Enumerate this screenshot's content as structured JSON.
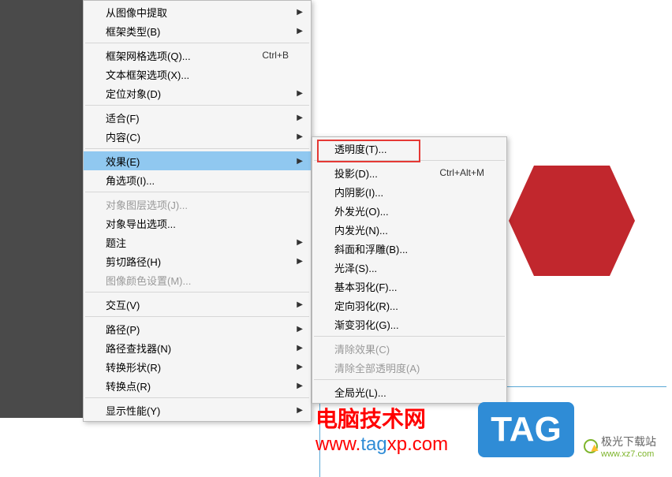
{
  "menu1": {
    "items": [
      {
        "label": "从图像中提取",
        "arrow": true
      },
      {
        "label": "框架类型(B)",
        "arrow": true
      },
      {
        "sep": true
      },
      {
        "label": "框架网格选项(Q)...",
        "accel": "Ctrl+B"
      },
      {
        "label": "文本框架选项(X)..."
      },
      {
        "label": "定位对象(D)",
        "arrow": true
      },
      {
        "sep": true
      },
      {
        "label": "适合(F)",
        "arrow": true
      },
      {
        "label": "内容(C)",
        "arrow": true
      },
      {
        "sep": true
      },
      {
        "label": "效果(E)",
        "arrow": true,
        "highlighted": true
      },
      {
        "label": "角选项(I)..."
      },
      {
        "sep": true
      },
      {
        "label": "对象图层选项(J)...",
        "disabled": true
      },
      {
        "label": "对象导出选项..."
      },
      {
        "label": "题注",
        "arrow": true
      },
      {
        "label": "剪切路径(H)",
        "arrow": true
      },
      {
        "label": "图像颜色设置(M)...",
        "disabled": true
      },
      {
        "sep": true
      },
      {
        "label": "交互(V)",
        "arrow": true
      },
      {
        "sep": true
      },
      {
        "label": "路径(P)",
        "arrow": true
      },
      {
        "label": "路径查找器(N)",
        "arrow": true
      },
      {
        "label": "转换形状(R)",
        "arrow": true
      },
      {
        "label": "转换点(R)",
        "arrow": true
      },
      {
        "sep": true
      },
      {
        "label": "显示性能(Y)",
        "arrow": true
      }
    ]
  },
  "menu2": {
    "items": [
      {
        "label": "透明度(T)..."
      },
      {
        "sep": true
      },
      {
        "label": "投影(D)...",
        "accel": "Ctrl+Alt+M"
      },
      {
        "label": "内阴影(I)..."
      },
      {
        "label": "外发光(O)..."
      },
      {
        "label": "内发光(N)..."
      },
      {
        "label": "斜面和浮雕(B)..."
      },
      {
        "label": "光泽(S)..."
      },
      {
        "label": "基本羽化(F)..."
      },
      {
        "label": "定向羽化(R)..."
      },
      {
        "label": "渐变羽化(G)..."
      },
      {
        "sep": true
      },
      {
        "label": "清除效果(C)",
        "disabled": true
      },
      {
        "label": "清除全部透明度(A)",
        "disabled": true
      },
      {
        "sep": true
      },
      {
        "label": "全局光(L)..."
      }
    ]
  },
  "watermarks": {
    "site1_name": "电脑技术网",
    "site1_url_pre": "www.",
    "site1_url_tag": "tag",
    "site1_url_post": "xp.com",
    "tag_badge": "TAG",
    "site2_name": "极光下载站",
    "site2_url": "www.xz7.com"
  }
}
